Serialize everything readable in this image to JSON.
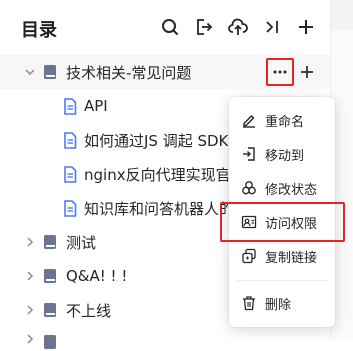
{
  "header": {
    "title": "目录",
    "icons": [
      "search-icon",
      "import-icon",
      "upload-icon",
      "collapse-icon",
      "add-icon"
    ]
  },
  "tree": {
    "items": [
      {
        "label": "技术相关-常见问题",
        "type": "book",
        "expanded": true
      },
      {
        "label": "API",
        "type": "doc"
      },
      {
        "label": "如何通过JS 调起 SDK",
        "type": "doc"
      },
      {
        "label": "nginx反向代理实现官网",
        "type": "doc"
      },
      {
        "label": "知识库和问答机器人的",
        "type": "doc"
      },
      {
        "label": "测试",
        "type": "book",
        "expanded": false
      },
      {
        "label": "Q&A! ! !",
        "type": "book",
        "expanded": false
      },
      {
        "label": "不上线",
        "type": "book",
        "expanded": false
      },
      {
        "label": "",
        "type": "book",
        "expanded": false
      }
    ]
  },
  "context_menu": {
    "items": [
      {
        "label": "重命名",
        "icon": "edit-icon"
      },
      {
        "label": "移动到",
        "icon": "move-icon"
      },
      {
        "label": "修改状态",
        "icon": "status-icon"
      },
      {
        "label": "访问权限",
        "icon": "permission-icon",
        "highlighted": true
      },
      {
        "label": "复制链接",
        "icon": "link-icon"
      },
      {
        "label": "删除",
        "icon": "trash-icon"
      }
    ]
  },
  "colors": {
    "accent": "#4a7cf6",
    "highlight_border": "#e5232a",
    "text": "#262626",
    "book": "#6b7591"
  }
}
